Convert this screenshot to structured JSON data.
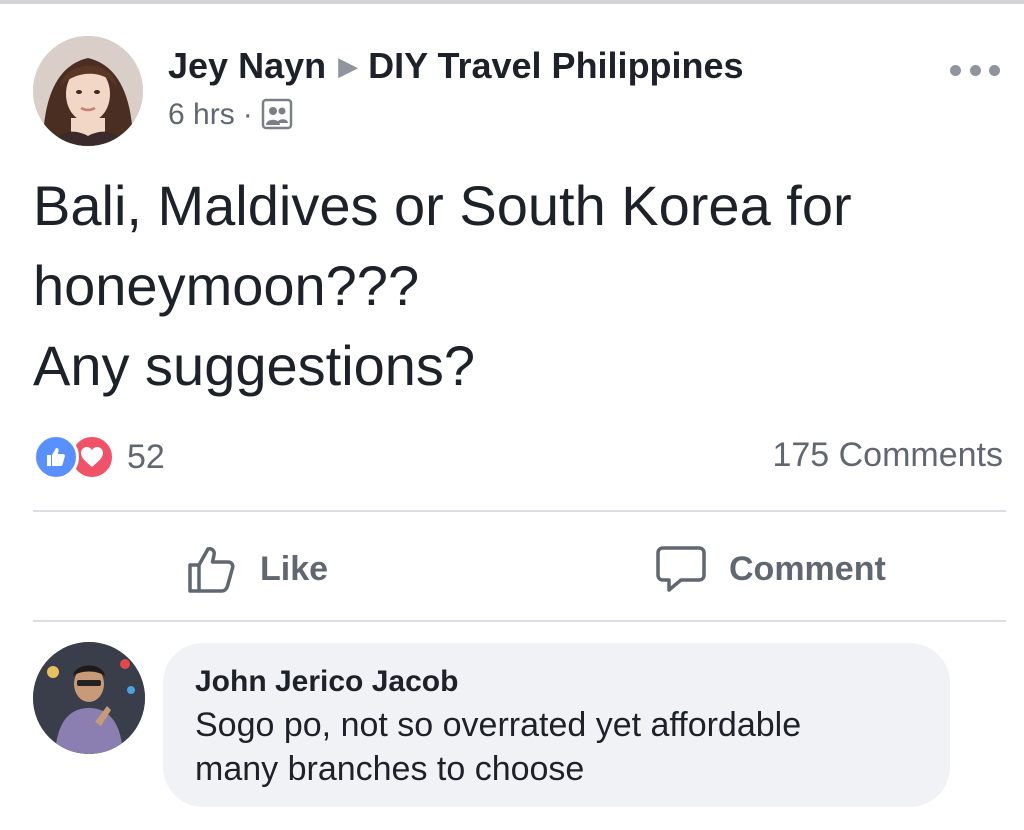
{
  "post": {
    "author": "Jey Nayn",
    "group": "DIY Travel Philippines",
    "time": "6 hrs",
    "separator": "·",
    "text_lines": [
      "Bali, Maldives or South Korea for",
      "honeymoon???",
      "Any suggestions?"
    ],
    "reaction_count": "52",
    "comments_count": "175 Comments",
    "icons": {
      "more": "more-options-icon",
      "audience": "group-audience-icon",
      "reactions": [
        "like-reaction-icon",
        "love-reaction-icon"
      ]
    },
    "colors": {
      "like_blue": "#5890ff",
      "love_red": "#f25268",
      "meta_gray": "#616770"
    }
  },
  "actions": {
    "like_label": "Like",
    "comment_label": "Comment"
  },
  "comment": {
    "author": "John Jerico Jacob",
    "text_lines": [
      "Sogo po, not so overrated yet affordable",
      "many branches to choose"
    ]
  }
}
